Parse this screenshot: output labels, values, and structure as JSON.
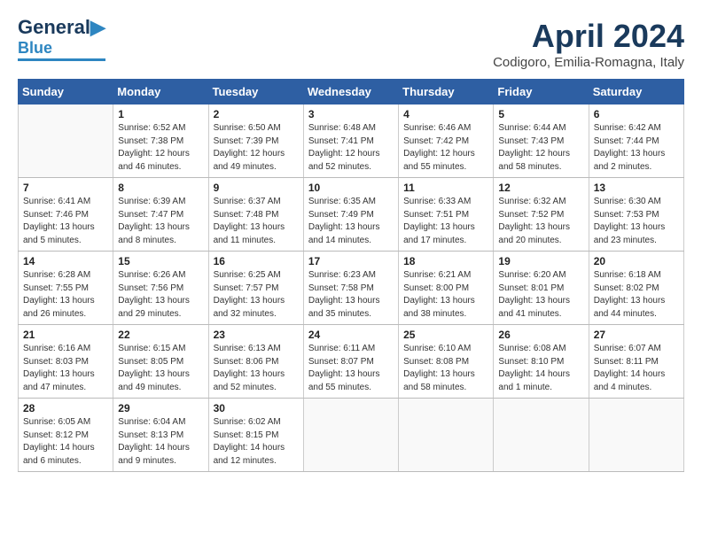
{
  "header": {
    "logo_line1": "General",
    "logo_line2": "Blue",
    "month": "April 2024",
    "location": "Codigoro, Emilia-Romagna, Italy"
  },
  "columns": [
    "Sunday",
    "Monday",
    "Tuesday",
    "Wednesday",
    "Thursday",
    "Friday",
    "Saturday"
  ],
  "weeks": [
    [
      {
        "day": "",
        "sunrise": "",
        "sunset": "",
        "daylight": ""
      },
      {
        "day": "1",
        "sunrise": "Sunrise: 6:52 AM",
        "sunset": "Sunset: 7:38 PM",
        "daylight": "Daylight: 12 hours and 46 minutes."
      },
      {
        "day": "2",
        "sunrise": "Sunrise: 6:50 AM",
        "sunset": "Sunset: 7:39 PM",
        "daylight": "Daylight: 12 hours and 49 minutes."
      },
      {
        "day": "3",
        "sunrise": "Sunrise: 6:48 AM",
        "sunset": "Sunset: 7:41 PM",
        "daylight": "Daylight: 12 hours and 52 minutes."
      },
      {
        "day": "4",
        "sunrise": "Sunrise: 6:46 AM",
        "sunset": "Sunset: 7:42 PM",
        "daylight": "Daylight: 12 hours and 55 minutes."
      },
      {
        "day": "5",
        "sunrise": "Sunrise: 6:44 AM",
        "sunset": "Sunset: 7:43 PM",
        "daylight": "Daylight: 12 hours and 58 minutes."
      },
      {
        "day": "6",
        "sunrise": "Sunrise: 6:42 AM",
        "sunset": "Sunset: 7:44 PM",
        "daylight": "Daylight: 13 hours and 2 minutes."
      }
    ],
    [
      {
        "day": "7",
        "sunrise": "Sunrise: 6:41 AM",
        "sunset": "Sunset: 7:46 PM",
        "daylight": "Daylight: 13 hours and 5 minutes."
      },
      {
        "day": "8",
        "sunrise": "Sunrise: 6:39 AM",
        "sunset": "Sunset: 7:47 PM",
        "daylight": "Daylight: 13 hours and 8 minutes."
      },
      {
        "day": "9",
        "sunrise": "Sunrise: 6:37 AM",
        "sunset": "Sunset: 7:48 PM",
        "daylight": "Daylight: 13 hours and 11 minutes."
      },
      {
        "day": "10",
        "sunrise": "Sunrise: 6:35 AM",
        "sunset": "Sunset: 7:49 PM",
        "daylight": "Daylight: 13 hours and 14 minutes."
      },
      {
        "day": "11",
        "sunrise": "Sunrise: 6:33 AM",
        "sunset": "Sunset: 7:51 PM",
        "daylight": "Daylight: 13 hours and 17 minutes."
      },
      {
        "day": "12",
        "sunrise": "Sunrise: 6:32 AM",
        "sunset": "Sunset: 7:52 PM",
        "daylight": "Daylight: 13 hours and 20 minutes."
      },
      {
        "day": "13",
        "sunrise": "Sunrise: 6:30 AM",
        "sunset": "Sunset: 7:53 PM",
        "daylight": "Daylight: 13 hours and 23 minutes."
      }
    ],
    [
      {
        "day": "14",
        "sunrise": "Sunrise: 6:28 AM",
        "sunset": "Sunset: 7:55 PM",
        "daylight": "Daylight: 13 hours and 26 minutes."
      },
      {
        "day": "15",
        "sunrise": "Sunrise: 6:26 AM",
        "sunset": "Sunset: 7:56 PM",
        "daylight": "Daylight: 13 hours and 29 minutes."
      },
      {
        "day": "16",
        "sunrise": "Sunrise: 6:25 AM",
        "sunset": "Sunset: 7:57 PM",
        "daylight": "Daylight: 13 hours and 32 minutes."
      },
      {
        "day": "17",
        "sunrise": "Sunrise: 6:23 AM",
        "sunset": "Sunset: 7:58 PM",
        "daylight": "Daylight: 13 hours and 35 minutes."
      },
      {
        "day": "18",
        "sunrise": "Sunrise: 6:21 AM",
        "sunset": "Sunset: 8:00 PM",
        "daylight": "Daylight: 13 hours and 38 minutes."
      },
      {
        "day": "19",
        "sunrise": "Sunrise: 6:20 AM",
        "sunset": "Sunset: 8:01 PM",
        "daylight": "Daylight: 13 hours and 41 minutes."
      },
      {
        "day": "20",
        "sunrise": "Sunrise: 6:18 AM",
        "sunset": "Sunset: 8:02 PM",
        "daylight": "Daylight: 13 hours and 44 minutes."
      }
    ],
    [
      {
        "day": "21",
        "sunrise": "Sunrise: 6:16 AM",
        "sunset": "Sunset: 8:03 PM",
        "daylight": "Daylight: 13 hours and 47 minutes."
      },
      {
        "day": "22",
        "sunrise": "Sunrise: 6:15 AM",
        "sunset": "Sunset: 8:05 PM",
        "daylight": "Daylight: 13 hours and 49 minutes."
      },
      {
        "day": "23",
        "sunrise": "Sunrise: 6:13 AM",
        "sunset": "Sunset: 8:06 PM",
        "daylight": "Daylight: 13 hours and 52 minutes."
      },
      {
        "day": "24",
        "sunrise": "Sunrise: 6:11 AM",
        "sunset": "Sunset: 8:07 PM",
        "daylight": "Daylight: 13 hours and 55 minutes."
      },
      {
        "day": "25",
        "sunrise": "Sunrise: 6:10 AM",
        "sunset": "Sunset: 8:08 PM",
        "daylight": "Daylight: 13 hours and 58 minutes."
      },
      {
        "day": "26",
        "sunrise": "Sunrise: 6:08 AM",
        "sunset": "Sunset: 8:10 PM",
        "daylight": "Daylight: 14 hours and 1 minute."
      },
      {
        "day": "27",
        "sunrise": "Sunrise: 6:07 AM",
        "sunset": "Sunset: 8:11 PM",
        "daylight": "Daylight: 14 hours and 4 minutes."
      }
    ],
    [
      {
        "day": "28",
        "sunrise": "Sunrise: 6:05 AM",
        "sunset": "Sunset: 8:12 PM",
        "daylight": "Daylight: 14 hours and 6 minutes."
      },
      {
        "day": "29",
        "sunrise": "Sunrise: 6:04 AM",
        "sunset": "Sunset: 8:13 PM",
        "daylight": "Daylight: 14 hours and 9 minutes."
      },
      {
        "day": "30",
        "sunrise": "Sunrise: 6:02 AM",
        "sunset": "Sunset: 8:15 PM",
        "daylight": "Daylight: 14 hours and 12 minutes."
      },
      {
        "day": "",
        "sunrise": "",
        "sunset": "",
        "daylight": ""
      },
      {
        "day": "",
        "sunrise": "",
        "sunset": "",
        "daylight": ""
      },
      {
        "day": "",
        "sunrise": "",
        "sunset": "",
        "daylight": ""
      },
      {
        "day": "",
        "sunrise": "",
        "sunset": "",
        "daylight": ""
      }
    ]
  ]
}
